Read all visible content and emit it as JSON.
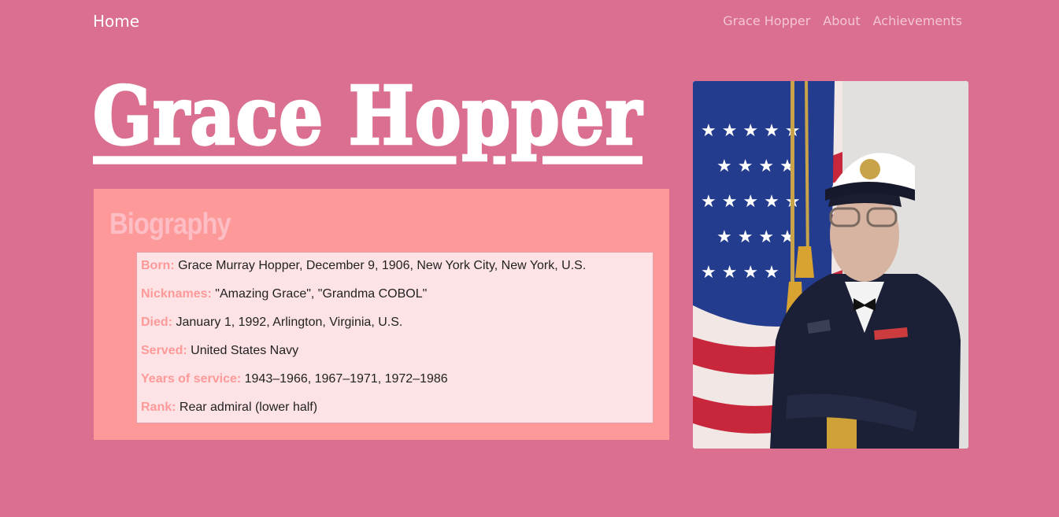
{
  "nav": {
    "home": "Home",
    "links": [
      "Grace Hopper",
      "About",
      "Achievements"
    ]
  },
  "title": "Grace Hopper",
  "biography": {
    "heading": "Biography",
    "items": [
      {
        "key": "Born:",
        "value": "Grace Murray Hopper, December 9, 1906, New York City, New York, U.S."
      },
      {
        "key": "Nicknames:",
        "value": "\"Amazing Grace\", \"Grandma COBOL\""
      },
      {
        "key": "Died:",
        "value": "January 1, 1992, Arlington, Virginia, U.S."
      },
      {
        "key": "Served:",
        "value": "United States Navy"
      },
      {
        "key": "Years of service:",
        "value": "1943–1966, 1967–1971, 1972–1986"
      },
      {
        "key": "Rank:",
        "value": "Rear admiral (lower half)"
      }
    ]
  },
  "colors": {
    "background": "#da6f8f",
    "panel": "#fe9999",
    "list_background": "#fde3e5",
    "heading": "#fdbdc4"
  }
}
